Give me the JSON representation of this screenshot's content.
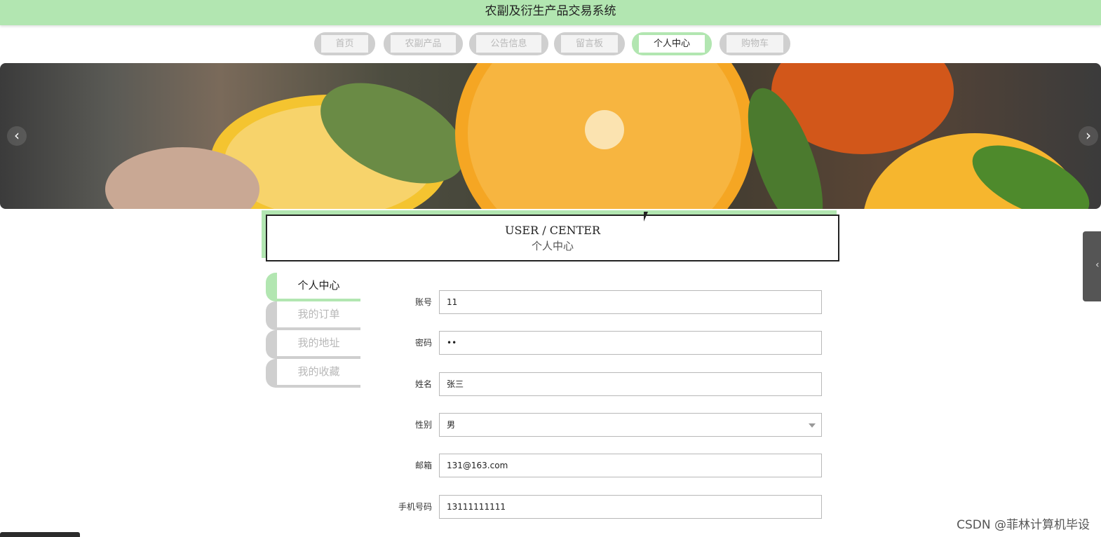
{
  "header": {
    "title": "农副及衍生产品交易系统"
  },
  "nav": {
    "items": [
      {
        "label": "首页",
        "active": false
      },
      {
        "label": "农副产品",
        "active": false
      },
      {
        "label": "公告信息",
        "active": false
      },
      {
        "label": "留言板",
        "active": false
      },
      {
        "label": "个人中心",
        "active": true
      },
      {
        "label": "购物车",
        "active": false
      }
    ]
  },
  "banner": {
    "prev_glyph": "‹",
    "next_glyph": "›"
  },
  "user_center": {
    "title_en": "USER / CENTER",
    "title_cn": "个人中心"
  },
  "side_menu": {
    "items": [
      {
        "label": "个人中心",
        "active": true
      },
      {
        "label": "我的订单",
        "active": false
      },
      {
        "label": "我的地址",
        "active": false
      },
      {
        "label": "我的收藏",
        "active": false
      }
    ]
  },
  "form": {
    "account": {
      "label": "账号",
      "value": "11"
    },
    "password": {
      "label": "密码",
      "value": "••"
    },
    "name": {
      "label": "姓名",
      "value": "张三"
    },
    "gender": {
      "label": "性别",
      "value": "男"
    },
    "email": {
      "label": "邮箱",
      "value": "131@163.com"
    },
    "phone": {
      "label": "手机号码",
      "value": "13111111111"
    }
  },
  "right_tab": {
    "glyph": "‹"
  },
  "watermark": "CSDN @菲林计算机毕设",
  "colors": {
    "accent": "#b2e6b1",
    "inactive": "#cfcfcf"
  }
}
